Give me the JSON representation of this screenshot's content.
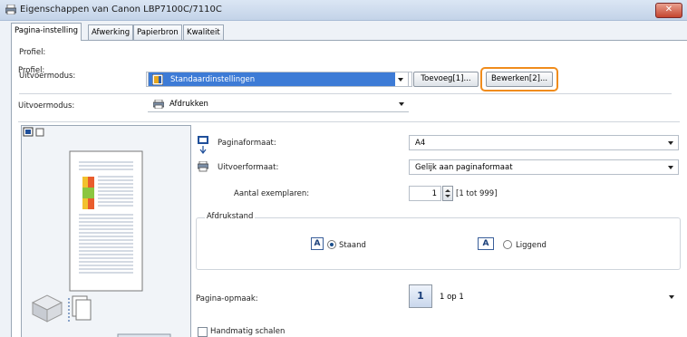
{
  "window": {
    "title": "Eigenschappen van Canon LBP7100C/7110C",
    "close_label": "✕"
  },
  "tabs": [
    {
      "label": "Pagina-instelling",
      "active": true
    },
    {
      "label": "Afwerking",
      "active": false
    },
    {
      "label": "Papierbron",
      "active": false
    },
    {
      "label": "Kwaliteit",
      "active": false
    }
  ],
  "profile": {
    "label": "Profiel:",
    "value": "Standaardinstellingen",
    "add_button": "Toevoeg[1]...",
    "edit_button": "Bewerken[2]..."
  },
  "output": {
    "label": "Uitvoermodus:",
    "value": "Afdrukken"
  },
  "page_size": {
    "label": "Paginaformaat:",
    "value": "A4"
  },
  "output_size": {
    "label": "Uitvoerformaat:",
    "value": "Gelijk aan paginaformaat"
  },
  "copies": {
    "label": "Aantal exemplaren:",
    "value": "1",
    "range": "[1 tot 999]"
  },
  "orientation": {
    "group_label": "Afdrukstand",
    "portrait_icon": "A",
    "portrait_label": "Staand",
    "landscape_icon": "A",
    "landscape_label": "Liggend",
    "selected": "Staand"
  },
  "layout": {
    "label": "Pagina-opmaak:",
    "value_number": "1",
    "value_text": "1 op 1"
  },
  "manual_scaling": {
    "label": "Handmatig schalen",
    "checked": false
  },
  "colors": {
    "highlight": "#f08c1c",
    "profile_selection": "#3d7bd6"
  }
}
